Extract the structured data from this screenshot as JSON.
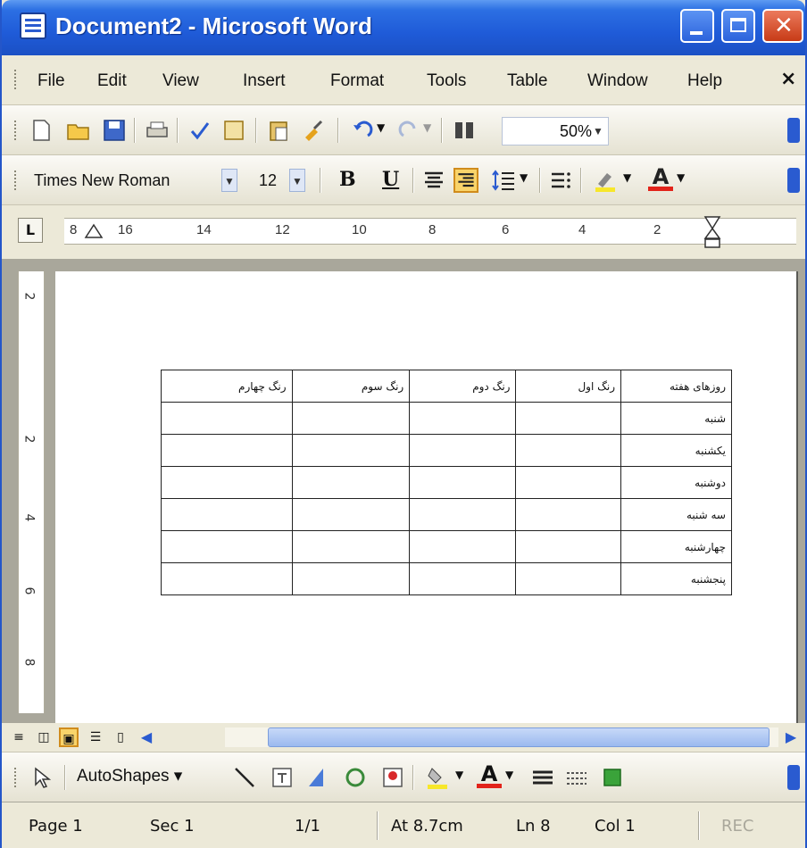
{
  "window": {
    "title": "Document2 - Microsoft Word"
  },
  "menu": [
    "File",
    "Edit",
    "View",
    "Insert",
    "Format",
    "Tools",
    "Table",
    "Window",
    "Help"
  ],
  "standard_toolbar": {
    "zoom": "50%"
  },
  "formatting_toolbar": {
    "font": "Times New Roman",
    "size": "12",
    "bold": "B",
    "underline": "U",
    "font_color": "A"
  },
  "ruler": {
    "tab_marker": "L",
    "labels": [
      "8",
      "16",
      "14",
      "12",
      "10",
      "8",
      "6",
      "4",
      "2"
    ]
  },
  "vruler": {
    "labels": [
      "2",
      "2",
      "4",
      "6",
      "8"
    ]
  },
  "table": {
    "headers": [
      "روزهای هفته",
      "رنگ اول",
      "رنگ دوم",
      "رنگ سوم",
      "رنگ چهارم"
    ],
    "rows": [
      "شنبه",
      "یکشنبه",
      "دوشنبه",
      "سه شنبه",
      "چهارشنبه",
      "پنجشنبه"
    ]
  },
  "drawing_toolbar": {
    "autoshapes": "AutoShapes",
    "font_color": "A"
  },
  "status": {
    "page": "Page 1",
    "sec": "Sec 1",
    "pages": "1/1",
    "at": "At 8.7cm",
    "ln": "Ln 8",
    "col": "Col 1",
    "rec": "REC"
  }
}
